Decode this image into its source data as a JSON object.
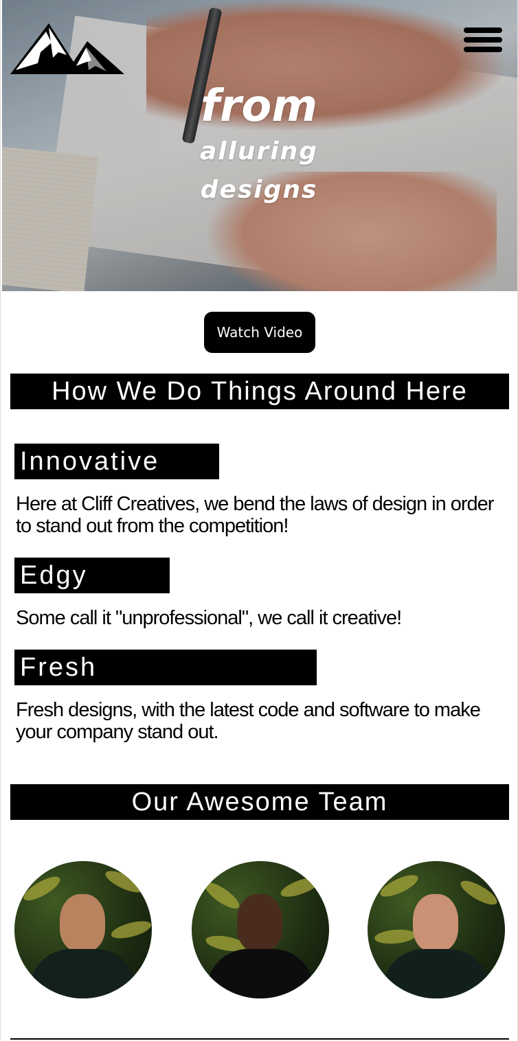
{
  "hero": {
    "tagline_line1": "from",
    "tagline_line2": "alluring",
    "tagline_line3": "designs"
  },
  "watch_video": {
    "label": "Watch Video"
  },
  "approach": {
    "heading": "How We Do Things Around Here",
    "items": [
      {
        "title": "Innovative",
        "text": "Here at Cliff Creatives, we bend the laws of design in order to stand out from the competition!"
      },
      {
        "title": "Edgy",
        "text": "Some call it \"unprofessional\", we call it creative!"
      },
      {
        "title": "Fresh",
        "text": "Fresh designs, with the latest code and software to make your company stand out."
      }
    ]
  },
  "team": {
    "heading": "Our Awesome Team",
    "members": [
      {
        "photo": "team-member-photo-1"
      },
      {
        "photo": "team-member-photo-2"
      },
      {
        "photo": "team-member-photo-3"
      }
    ]
  },
  "icons": {
    "logo": "mountain-logo-icon",
    "menu": "hamburger-menu-icon"
  },
  "colors": {
    "banner_bg": "#000000",
    "banner_text": "#ffffff",
    "page_bg": "#ffffff"
  }
}
